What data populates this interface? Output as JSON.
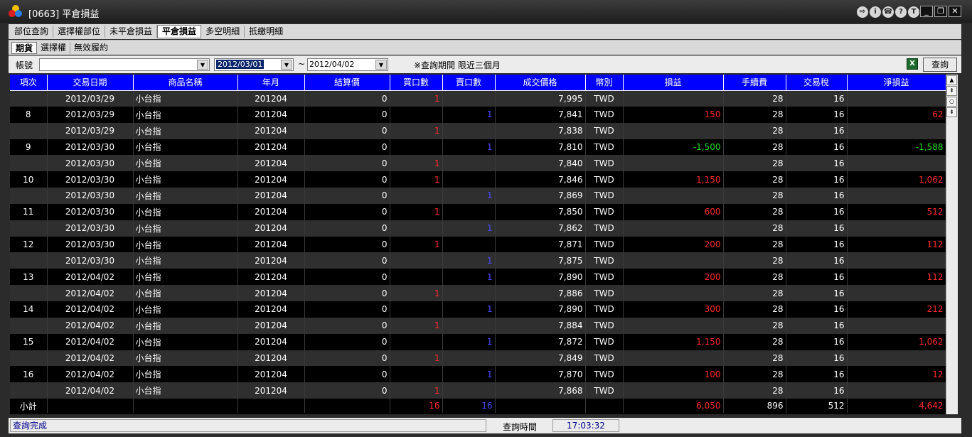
{
  "window": {
    "title": "[0663] 平倉損益",
    "colors": {
      "title_bg": "#1e1e1e",
      "header_bg": "#0000ff",
      "positive": "#ff2a2a",
      "negative": "#22dd22",
      "sell_qty": "#4a4aff"
    },
    "title_icons": [
      "exit-icon",
      "info-icon",
      "phone-icon",
      "help-icon",
      "t-icon"
    ],
    "window_buttons": [
      "minimize-icon",
      "restore-icon",
      "close-icon"
    ]
  },
  "tabs": [
    "部位查詢",
    "選擇權部位",
    "未平倉損益",
    "平倉損益",
    "多空明細",
    "抵繳明細"
  ],
  "active_tab": "平倉損益",
  "subtabs": [
    "期貨",
    "選擇權",
    "無效履約"
  ],
  "active_subtab": "期貨",
  "filter": {
    "account_label": "帳號",
    "account_value": "",
    "date_from": "2012/03/01",
    "tilde": "~",
    "date_to": "2012/04/02",
    "note": "※查詢期間 限近三個月",
    "query_button": "查詢"
  },
  "columns": [
    "項次",
    "交易日期",
    "商品名稱",
    "年月",
    "結算價",
    "買口數",
    "賣口數",
    "成交價格",
    "幣別",
    "損益",
    "手續費",
    "交易稅",
    "淨損益"
  ],
  "rows": [
    [
      "",
      "2012/03/29",
      "小台指",
      "201204",
      "0",
      "1",
      "",
      "7,995",
      "TWD",
      "",
      "28",
      "16",
      ""
    ],
    [
      "8",
      "2012/03/29",
      "小台指",
      "201204",
      "0",
      "",
      "1",
      "7,841",
      "TWD",
      "150",
      "28",
      "16",
      "62"
    ],
    [
      "",
      "2012/03/29",
      "小台指",
      "201204",
      "0",
      "1",
      "",
      "7,838",
      "TWD",
      "",
      "28",
      "16",
      ""
    ],
    [
      "9",
      "2012/03/30",
      "小台指",
      "201204",
      "0",
      "",
      "1",
      "7,810",
      "TWD",
      "-1,500",
      "28",
      "16",
      "-1,588"
    ],
    [
      "",
      "2012/03/30",
      "小台指",
      "201204",
      "0",
      "1",
      "",
      "7,840",
      "TWD",
      "",
      "28",
      "16",
      ""
    ],
    [
      "10",
      "2012/03/30",
      "小台指",
      "201204",
      "0",
      "1",
      "",
      "7,846",
      "TWD",
      "1,150",
      "28",
      "16",
      "1,062"
    ],
    [
      "",
      "2012/03/30",
      "小台指",
      "201204",
      "0",
      "",
      "1",
      "7,869",
      "TWD",
      "",
      "28",
      "16",
      ""
    ],
    [
      "11",
      "2012/03/30",
      "小台指",
      "201204",
      "0",
      "1",
      "",
      "7,850",
      "TWD",
      "600",
      "28",
      "16",
      "512"
    ],
    [
      "",
      "2012/03/30",
      "小台指",
      "201204",
      "0",
      "",
      "1",
      "7,862",
      "TWD",
      "",
      "28",
      "16",
      ""
    ],
    [
      "12",
      "2012/03/30",
      "小台指",
      "201204",
      "0",
      "1",
      "",
      "7,871",
      "TWD",
      "200",
      "28",
      "16",
      "112"
    ],
    [
      "",
      "2012/03/30",
      "小台指",
      "201204",
      "0",
      "",
      "1",
      "7,875",
      "TWD",
      "",
      "28",
      "16",
      ""
    ],
    [
      "13",
      "2012/04/02",
      "小台指",
      "201204",
      "0",
      "",
      "1",
      "7,890",
      "TWD",
      "200",
      "28",
      "16",
      "112"
    ],
    [
      "",
      "2012/04/02",
      "小台指",
      "201204",
      "0",
      "1",
      "",
      "7,886",
      "TWD",
      "",
      "28",
      "16",
      ""
    ],
    [
      "14",
      "2012/04/02",
      "小台指",
      "201204",
      "0",
      "",
      "1",
      "7,890",
      "TWD",
      "300",
      "28",
      "16",
      "212"
    ],
    [
      "",
      "2012/04/02",
      "小台指",
      "201204",
      "0",
      "1",
      "",
      "7,884",
      "TWD",
      "",
      "28",
      "16",
      ""
    ],
    [
      "15",
      "2012/04/02",
      "小台指",
      "201204",
      "0",
      "",
      "1",
      "7,872",
      "TWD",
      "1,150",
      "28",
      "16",
      "1,062"
    ],
    [
      "",
      "2012/04/02",
      "小台指",
      "201204",
      "0",
      "1",
      "",
      "7,849",
      "TWD",
      "",
      "28",
      "16",
      ""
    ],
    [
      "16",
      "2012/04/02",
      "小台指",
      "201204",
      "0",
      "",
      "1",
      "7,870",
      "TWD",
      "100",
      "28",
      "16",
      "12"
    ],
    [
      "",
      "2012/04/02",
      "小台指",
      "201204",
      "0",
      "1",
      "",
      "7,868",
      "TWD",
      "",
      "28",
      "16",
      ""
    ]
  ],
  "subtotal": [
    "小計",
    "",
    "",
    "",
    "",
    "16",
    "16",
    "",
    "",
    "6,050",
    "896",
    "512",
    "4,642"
  ],
  "status": {
    "text": "查詢完成",
    "time_label": "查詢時間",
    "time_value": "17:03:32"
  }
}
